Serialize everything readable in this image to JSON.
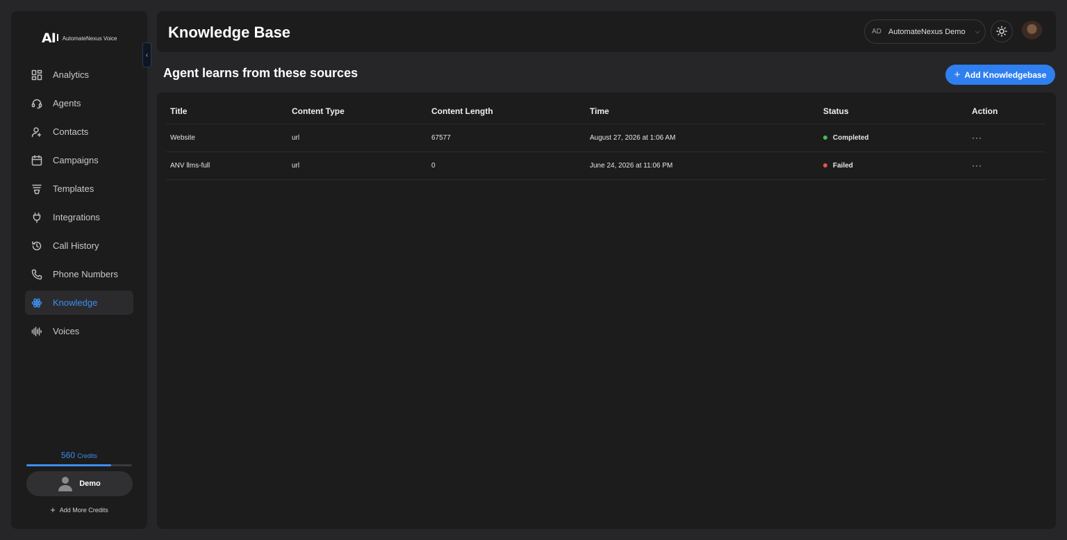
{
  "brand": {
    "mark": "AI",
    "name": "AutomateNexus Voice"
  },
  "sidebar": {
    "items": [
      {
        "label": "Analytics",
        "icon": "grid-icon"
      },
      {
        "label": "Agents",
        "icon": "headset-icon"
      },
      {
        "label": "Contacts",
        "icon": "user-add-icon"
      },
      {
        "label": "Campaigns",
        "icon": "calendar-icon"
      },
      {
        "label": "Templates",
        "icon": "funnel-icon"
      },
      {
        "label": "Integrations",
        "icon": "plug-icon"
      },
      {
        "label": "Call History",
        "icon": "history-icon"
      },
      {
        "label": "Phone Numbers",
        "icon": "phone-icon"
      },
      {
        "label": "Knowledge",
        "icon": "atom-icon",
        "active": true
      },
      {
        "label": "Voices",
        "icon": "waveform-icon"
      }
    ],
    "credits": {
      "amount": "560",
      "unit": "Credits",
      "fill_percent": 80
    },
    "user": {
      "name": "Demo"
    },
    "add_credits_label": "Add More Credits"
  },
  "header": {
    "title": "Knowledge Base",
    "org": {
      "initials": "AD",
      "name": "AutomateNexus Demo"
    }
  },
  "main": {
    "section_title": "Agent learns from these sources",
    "add_button_label": "Add Knowledgebase",
    "table": {
      "columns": [
        "Title",
        "Content Type",
        "Content Length",
        "Time",
        "Status",
        "Action"
      ],
      "rows": [
        {
          "title": "Website",
          "content_type": "url",
          "content_length": "67577",
          "time": "August 27, 2026 at 1:06 AM",
          "status": "Completed",
          "status_color": "#3fbf5a",
          "action": "···"
        },
        {
          "title": "ANV llms-full",
          "content_type": "url",
          "content_length": "0",
          "time": "June 24, 2026 at 11:06 PM",
          "status": "Failed",
          "status_color": "#e5534b",
          "action": "···"
        }
      ]
    }
  },
  "colors": {
    "accent": "#3d8ef0",
    "button": "#2f7ff0"
  }
}
